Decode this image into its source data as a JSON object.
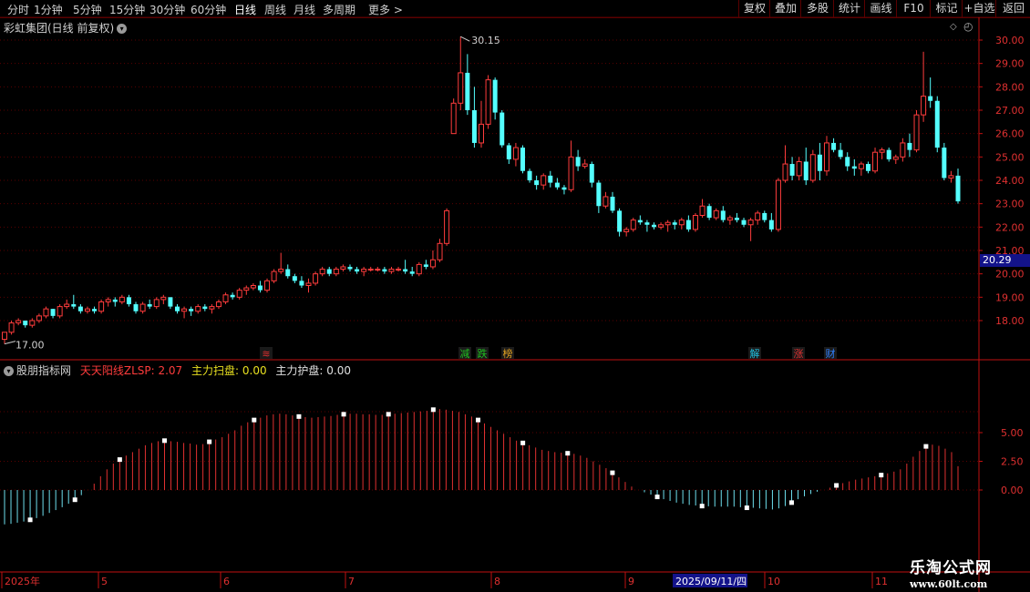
{
  "toolbar": {
    "periods": [
      "分时",
      "1分钟",
      "5分钟",
      "15分钟",
      "30分钟",
      "60分钟",
      "日线",
      "周线",
      "月线",
      "多周期",
      "更多 >"
    ],
    "active_period": "日线",
    "right_buttons": [
      "复权",
      "叠加",
      "多股",
      "统计",
      "画线",
      "F10",
      "标记",
      "+自选",
      "返回"
    ]
  },
  "main": {
    "title": "彩虹集团(日线 前复权)",
    "high_label": "30.15",
    "low_label": "17.00",
    "current_price": "20.29",
    "y_ticks": [
      "30.00",
      "29.00",
      "28.00",
      "27.00",
      "26.00",
      "25.00",
      "24.00",
      "23.00",
      "22.00",
      "21.00",
      "20.00",
      "19.00",
      "18.00"
    ]
  },
  "event_markers": [
    {
      "text": "≋",
      "color": "#e03030"
    },
    {
      "text": "减",
      "color": "#20c020"
    },
    {
      "text": "跌",
      "color": "#20c020"
    },
    {
      "text": "榜",
      "color": "#e0a020"
    },
    {
      "text": "解",
      "color": "#20c0e0"
    },
    {
      "text": "涨",
      "color": "#e03030"
    },
    {
      "text": "财",
      "color": "#3080ff"
    }
  ],
  "indicator": {
    "name": "股朋指标网",
    "line1": "天天阳线ZLSP: 2.07",
    "line2": "主力扫盘: 0.00",
    "line3": "主力护盘: 0.00",
    "y_ticks": [
      "5.00",
      "2.50",
      "0.00"
    ]
  },
  "x_axis": {
    "labels": [
      "2025年",
      "5",
      "6",
      "7",
      "8",
      "9",
      "10",
      "11"
    ],
    "highlight": "2025/09/11/四"
  },
  "logo": {
    "line1": "乐淘公式网",
    "line2": "www.60lt.com"
  },
  "colors": {
    "up": "#ff3c3c",
    "down": "#54ffff",
    "grid": "#5a0000",
    "axis": "#c01010"
  },
  "chart_data": {
    "type": "candlestick",
    "y_range": [
      17.0,
      30.15
    ],
    "candles": [
      [
        17.2,
        17.5,
        17.0,
        17.5
      ],
      [
        17.5,
        18.0,
        17.4,
        17.9
      ],
      [
        17.9,
        18.1,
        17.8,
        18.0
      ],
      [
        18.0,
        18.0,
        17.7,
        17.8
      ],
      [
        17.8,
        18.1,
        17.7,
        18.0
      ],
      [
        18.0,
        18.3,
        17.9,
        18.2
      ],
      [
        18.2,
        18.6,
        18.1,
        18.5
      ],
      [
        18.5,
        18.5,
        18.1,
        18.2
      ],
      [
        18.2,
        18.7,
        18.1,
        18.6
      ],
      [
        18.6,
        18.9,
        18.5,
        18.7
      ],
      [
        18.7,
        19.1,
        18.5,
        18.6
      ],
      [
        18.6,
        18.7,
        18.3,
        18.4
      ],
      [
        18.4,
        18.6,
        18.3,
        18.5
      ],
      [
        18.5,
        18.6,
        18.3,
        18.4
      ],
      [
        18.4,
        18.9,
        18.3,
        18.8
      ],
      [
        18.8,
        19.0,
        18.6,
        18.9
      ],
      [
        18.9,
        19.0,
        18.6,
        18.8
      ],
      [
        18.8,
        19.1,
        18.7,
        19.0
      ],
      [
        19.0,
        19.1,
        18.6,
        18.7
      ],
      [
        18.7,
        18.8,
        18.3,
        18.4
      ],
      [
        18.4,
        18.8,
        18.3,
        18.7
      ],
      [
        18.7,
        18.9,
        18.5,
        18.6
      ],
      [
        18.6,
        19.0,
        18.5,
        18.9
      ],
      [
        18.9,
        19.1,
        18.7,
        19.0
      ],
      [
        19.0,
        19.0,
        18.5,
        18.6
      ],
      [
        18.6,
        18.7,
        18.3,
        18.4
      ],
      [
        18.4,
        18.6,
        18.1,
        18.5
      ],
      [
        18.5,
        18.6,
        18.2,
        18.4
      ],
      [
        18.4,
        18.7,
        18.3,
        18.6
      ],
      [
        18.6,
        18.7,
        18.4,
        18.5
      ],
      [
        18.5,
        18.7,
        18.3,
        18.6
      ],
      [
        18.6,
        18.9,
        18.5,
        18.8
      ],
      [
        18.8,
        19.2,
        18.7,
        19.1
      ],
      [
        19.1,
        19.2,
        18.9,
        19.0
      ],
      [
        19.0,
        19.4,
        18.9,
        19.3
      ],
      [
        19.3,
        19.5,
        19.1,
        19.4
      ],
      [
        19.4,
        19.6,
        19.3,
        19.5
      ],
      [
        19.5,
        19.7,
        19.2,
        19.3
      ],
      [
        19.3,
        19.8,
        19.2,
        19.7
      ],
      [
        19.7,
        20.2,
        19.6,
        20.1
      ],
      [
        20.1,
        20.9,
        20.0,
        20.2
      ],
      [
        20.2,
        20.4,
        19.8,
        19.9
      ],
      [
        19.9,
        20.0,
        19.6,
        19.7
      ],
      [
        19.7,
        19.9,
        19.4,
        19.5
      ],
      [
        19.5,
        19.8,
        19.2,
        19.6
      ],
      [
        19.6,
        20.1,
        19.5,
        20.0
      ],
      [
        20.0,
        20.3,
        19.9,
        20.2
      ],
      [
        20.2,
        20.3,
        19.9,
        20.0
      ],
      [
        20.0,
        20.3,
        19.9,
        20.2
      ],
      [
        20.2,
        20.4,
        20.1,
        20.3
      ],
      [
        20.3,
        20.4,
        20.1,
        20.2
      ],
      [
        20.2,
        20.3,
        20.0,
        20.1
      ],
      [
        20.1,
        20.3,
        19.9,
        20.2
      ],
      [
        20.2,
        20.3,
        20.1,
        20.2
      ],
      [
        20.2,
        20.3,
        20.1,
        20.2
      ],
      [
        20.2,
        20.3,
        20.0,
        20.1
      ],
      [
        20.1,
        20.3,
        20.0,
        20.2
      ],
      [
        20.2,
        20.3,
        20.1,
        20.2
      ],
      [
        20.2,
        20.6,
        20.0,
        20.1
      ],
      [
        20.1,
        20.3,
        19.9,
        20.0
      ],
      [
        20.0,
        20.5,
        19.9,
        20.4
      ],
      [
        20.4,
        20.6,
        20.2,
        20.3
      ],
      [
        20.3,
        21.0,
        20.2,
        20.6
      ],
      [
        20.6,
        21.5,
        20.5,
        21.3
      ],
      [
        21.3,
        22.8,
        21.2,
        22.7
      ],
      [
        26.0,
        27.5,
        26.0,
        27.3
      ],
      [
        27.3,
        30.15,
        27.0,
        28.6
      ],
      [
        28.6,
        29.4,
        26.8,
        27.0
      ],
      [
        27.0,
        28.0,
        25.4,
        25.6
      ],
      [
        25.6,
        27.4,
        25.4,
        26.4
      ],
      [
        26.4,
        28.5,
        26.2,
        28.3
      ],
      [
        28.3,
        28.4,
        26.6,
        26.9
      ],
      [
        26.9,
        27.0,
        25.4,
        25.5
      ],
      [
        25.5,
        25.6,
        24.7,
        24.9
      ],
      [
        24.9,
        25.6,
        24.6,
        25.4
      ],
      [
        25.4,
        25.5,
        24.3,
        24.4
      ],
      [
        24.4,
        24.5,
        23.9,
        24.0
      ],
      [
        24.0,
        24.2,
        23.6,
        23.8
      ],
      [
        23.8,
        24.3,
        23.6,
        24.2
      ],
      [
        24.2,
        24.4,
        23.7,
        23.9
      ],
      [
        23.9,
        24.1,
        23.6,
        23.7
      ],
      [
        23.7,
        23.8,
        23.4,
        23.6
      ],
      [
        23.6,
        25.7,
        23.5,
        25.0
      ],
      [
        25.0,
        25.3,
        24.4,
        24.6
      ],
      [
        24.6,
        24.9,
        24.5,
        24.7
      ],
      [
        24.7,
        24.8,
        23.7,
        23.9
      ],
      [
        23.9,
        24.0,
        22.6,
        22.9
      ],
      [
        22.9,
        23.5,
        22.8,
        23.3
      ],
      [
        23.3,
        23.5,
        22.6,
        22.7
      ],
      [
        22.7,
        22.8,
        21.6,
        21.8
      ],
      [
        21.8,
        22.0,
        21.6,
        21.9
      ],
      [
        21.9,
        22.4,
        21.8,
        22.3
      ],
      [
        22.3,
        22.5,
        22.1,
        22.2
      ],
      [
        22.2,
        22.3,
        21.8,
        22.1
      ],
      [
        22.1,
        22.2,
        21.9,
        22.0
      ],
      [
        22.0,
        22.2,
        21.9,
        22.1
      ],
      [
        22.1,
        22.3,
        21.8,
        22.2
      ],
      [
        22.2,
        22.3,
        21.9,
        22.1
      ],
      [
        22.1,
        22.4,
        21.9,
        22.3
      ],
      [
        22.3,
        22.5,
        21.8,
        21.9
      ],
      [
        21.9,
        22.6,
        21.8,
        22.5
      ],
      [
        22.5,
        23.2,
        22.4,
        22.9
      ],
      [
        22.9,
        23.0,
        22.3,
        22.4
      ],
      [
        22.4,
        22.8,
        22.3,
        22.7
      ],
      [
        22.7,
        22.9,
        22.2,
        22.3
      ],
      [
        22.3,
        22.5,
        22.1,
        22.4
      ],
      [
        22.4,
        22.6,
        22.2,
        22.3
      ],
      [
        22.3,
        22.4,
        22.0,
        22.1
      ],
      [
        22.1,
        22.4,
        21.4,
        22.3
      ],
      [
        22.3,
        22.7,
        22.1,
        22.6
      ],
      [
        22.6,
        22.7,
        22.2,
        22.3
      ],
      [
        22.3,
        22.6,
        21.8,
        21.9
      ],
      [
        21.9,
        24.1,
        21.8,
        24.0
      ],
      [
        24.0,
        25.5,
        23.9,
        24.7
      ],
      [
        24.7,
        25.0,
        24.0,
        24.2
      ],
      [
        24.2,
        25.0,
        24.0,
        24.8
      ],
      [
        24.8,
        25.4,
        23.8,
        24.0
      ],
      [
        24.0,
        25.3,
        23.9,
        25.1
      ],
      [
        25.1,
        25.6,
        24.0,
        24.4
      ],
      [
        24.4,
        25.9,
        24.2,
        25.6
      ],
      [
        25.6,
        25.8,
        25.2,
        25.3
      ],
      [
        25.3,
        25.6,
        24.9,
        25.0
      ],
      [
        25.0,
        25.2,
        24.4,
        24.6
      ],
      [
        24.6,
        24.9,
        24.2,
        24.5
      ],
      [
        24.5,
        24.8,
        24.2,
        24.7
      ],
      [
        24.7,
        24.8,
        24.3,
        24.4
      ],
      [
        24.4,
        25.4,
        24.3,
        25.2
      ],
      [
        25.2,
        25.4,
        24.9,
        25.3
      ],
      [
        25.3,
        25.4,
        24.8,
        24.9
      ],
      [
        24.9,
        25.1,
        24.7,
        25.0
      ],
      [
        25.0,
        25.8,
        24.8,
        25.6
      ],
      [
        25.6,
        26.0,
        25.0,
        25.3
      ],
      [
        25.3,
        27.0,
        25.2,
        26.8
      ],
      [
        26.8,
        29.5,
        26.5,
        27.6
      ],
      [
        27.6,
        28.4,
        27.1,
        27.4
      ],
      [
        27.4,
        27.6,
        25.2,
        25.4
      ],
      [
        25.4,
        25.6,
        24.0,
        24.1
      ],
      [
        24.1,
        24.4,
        23.9,
        24.2
      ],
      [
        24.2,
        24.5,
        23.0,
        23.1
      ]
    ],
    "indicator": {
      "type": "bar",
      "values": [
        -3.0,
        -2.95,
        -2.85,
        -2.75,
        -2.6,
        -2.45,
        -2.25,
        -2.0,
        -1.75,
        -1.5,
        -1.2,
        -0.85,
        -0.45,
        0.0,
        0.55,
        1.2,
        1.8,
        2.3,
        2.65,
        3.0,
        3.3,
        3.6,
        3.9,
        4.1,
        4.25,
        4.3,
        4.25,
        4.2,
        4.1,
        4.05,
        3.95,
        4.0,
        4.2,
        4.4,
        4.6,
        4.9,
        5.2,
        5.6,
        5.9,
        6.1,
        6.3,
        6.5,
        6.6,
        6.65,
        6.6,
        6.5,
        6.4,
        6.35,
        6.3,
        6.35,
        6.4,
        6.45,
        6.55,
        6.6,
        6.65,
        6.65,
        6.6,
        6.6,
        6.55,
        6.55,
        6.6,
        6.65,
        6.7,
        6.75,
        6.8,
        6.85,
        6.9,
        7.0,
        7.05,
        7.0,
        6.9,
        6.8,
        6.6,
        6.4,
        6.1,
        5.8,
        5.5,
        5.2,
        4.9,
        4.6,
        4.3,
        4.1,
        3.9,
        3.7,
        3.5,
        3.4,
        3.3,
        3.25,
        3.2,
        3.15,
        3.0,
        2.8,
        2.5,
        2.2,
        1.9,
        1.5,
        1.1,
        0.7,
        0.3,
        0.0,
        -0.2,
        -0.4,
        -0.6,
        -0.8,
        -0.95,
        -1.1,
        -1.2,
        -1.3,
        -1.35,
        -1.4,
        -1.42,
        -1.45,
        -1.45,
        -1.45,
        -1.45,
        -1.5,
        -1.55,
        -1.55,
        -1.6,
        -1.65,
        -1.7,
        -1.6,
        -1.4,
        -1.1,
        -0.8,
        -0.55,
        -0.35,
        -0.15,
        0.0,
        0.2,
        0.4,
        0.6,
        0.75,
        0.9,
        1.0,
        1.1,
        1.2,
        1.3,
        1.45,
        1.6,
        1.8,
        2.3,
        2.9,
        3.4,
        3.8,
        3.95,
        3.85,
        3.6,
        3.3,
        2.07
      ]
    }
  }
}
